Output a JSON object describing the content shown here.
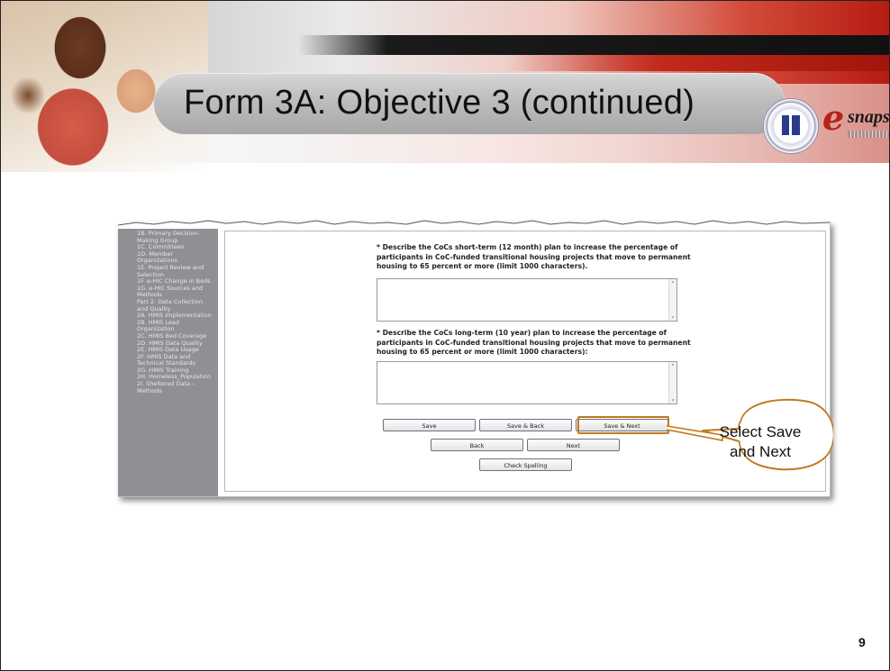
{
  "slide": {
    "title": "Form 3A:  Objective 3 (continued)",
    "page_number": "9"
  },
  "callout": {
    "text": "Select Save and  Next"
  },
  "logo": {
    "e": "e",
    "word": "snaps"
  },
  "sidebar": {
    "items": [
      "1B. Primary Decision-Making Group",
      "1C. Committees",
      "1D. Member Organizations",
      "1E. Project Review and Selection",
      "1F. e-HIC Change in Beds",
      "1G. e-HIC Sources and Methods",
      "Part 2: Data Collection and Quality",
      "2A. HMIS Implementation",
      "2B. HMIS Lead Organization",
      "2C. HMIS Bed Coverage",
      "2D. HMIS Data Quality",
      "2E. HMIS Data Usage",
      "2F. HMIS Data and Technical Standards",
      "2G. HMIS Training",
      "2H. Homeless_Population",
      "2I. Sheltered Data - Methods"
    ]
  },
  "form": {
    "question1": "* Describe the CoCs short-term (12 month) plan to increase the percentage of participants in CoC-funded transitional housing projects that move to permanent housing to 65 percent or more (limit 1000 characters).",
    "question2": "* Describe the CoCs long-term (10 year) plan to increase the percentage of participants in CoC-funded transitional housing projects that move to permanent housing to 65 percent or more (limit 1000 characters):",
    "answer1": "",
    "answer2": ""
  },
  "buttons": {
    "save": "Save",
    "save_back": "Save & Back",
    "save_next": "Save & Next",
    "back": "Back",
    "next": "Next",
    "check_spelling": "Check Spelling"
  },
  "colors": {
    "callout_border": "#c07a1d",
    "sidebar_bg": "#8e9094",
    "brand_red": "#b5231a"
  }
}
